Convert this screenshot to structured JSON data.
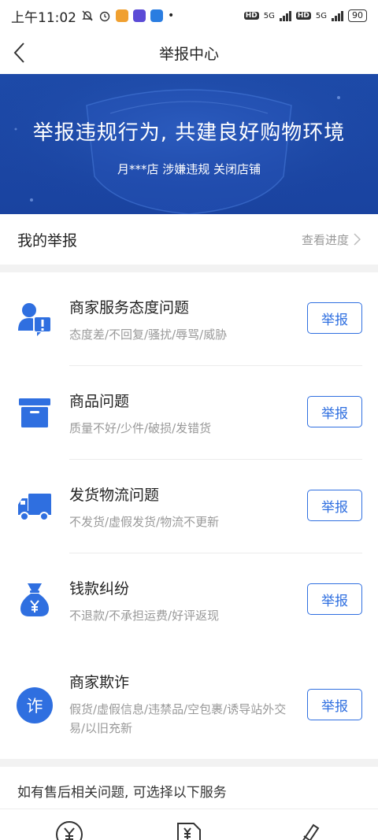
{
  "status_bar": {
    "time": "上午11:02",
    "network1": "5G",
    "network2": "5G",
    "hd1": "HD",
    "hd2": "HD",
    "battery": "90"
  },
  "nav": {
    "title": "举报中心"
  },
  "banner": {
    "title": "举报违规行为, 共建良好购物环境",
    "subtitle": "月***店 涉嫌违规 关闭店铺"
  },
  "my_report": {
    "title": "我的举报",
    "link": "查看进度"
  },
  "report_items": [
    {
      "title": "商家服务态度问题",
      "desc": "态度差/不回复/骚扰/辱骂/威胁",
      "button": "举报",
      "icon": "service-attitude-icon"
    },
    {
      "title": "商品问题",
      "desc": "质量不好/少件/破损/发错货",
      "button": "举报",
      "icon": "product-box-icon"
    },
    {
      "title": "发货物流问题",
      "desc": "不发货/虚假发货/物流不更新",
      "button": "举报",
      "icon": "delivery-truck-icon"
    },
    {
      "title": "钱款纠纷",
      "desc": "不退款/不承担运费/好评返现",
      "button": "举报",
      "icon": "money-bag-icon"
    },
    {
      "title": "商家欺诈",
      "desc": "假货/虚假信息/违禁品/空包裹/诱导站外交易/以旧充新",
      "button": "举报",
      "icon": "fraud-icon",
      "fraud_glyph": "诈"
    }
  ],
  "service": {
    "title": "如有售后相关问题, 可选择以下服务"
  },
  "colors": {
    "accent": "#2f6fe0",
    "banner": "#1d4aa8",
    "icon_blue": "#2f6fe0"
  }
}
